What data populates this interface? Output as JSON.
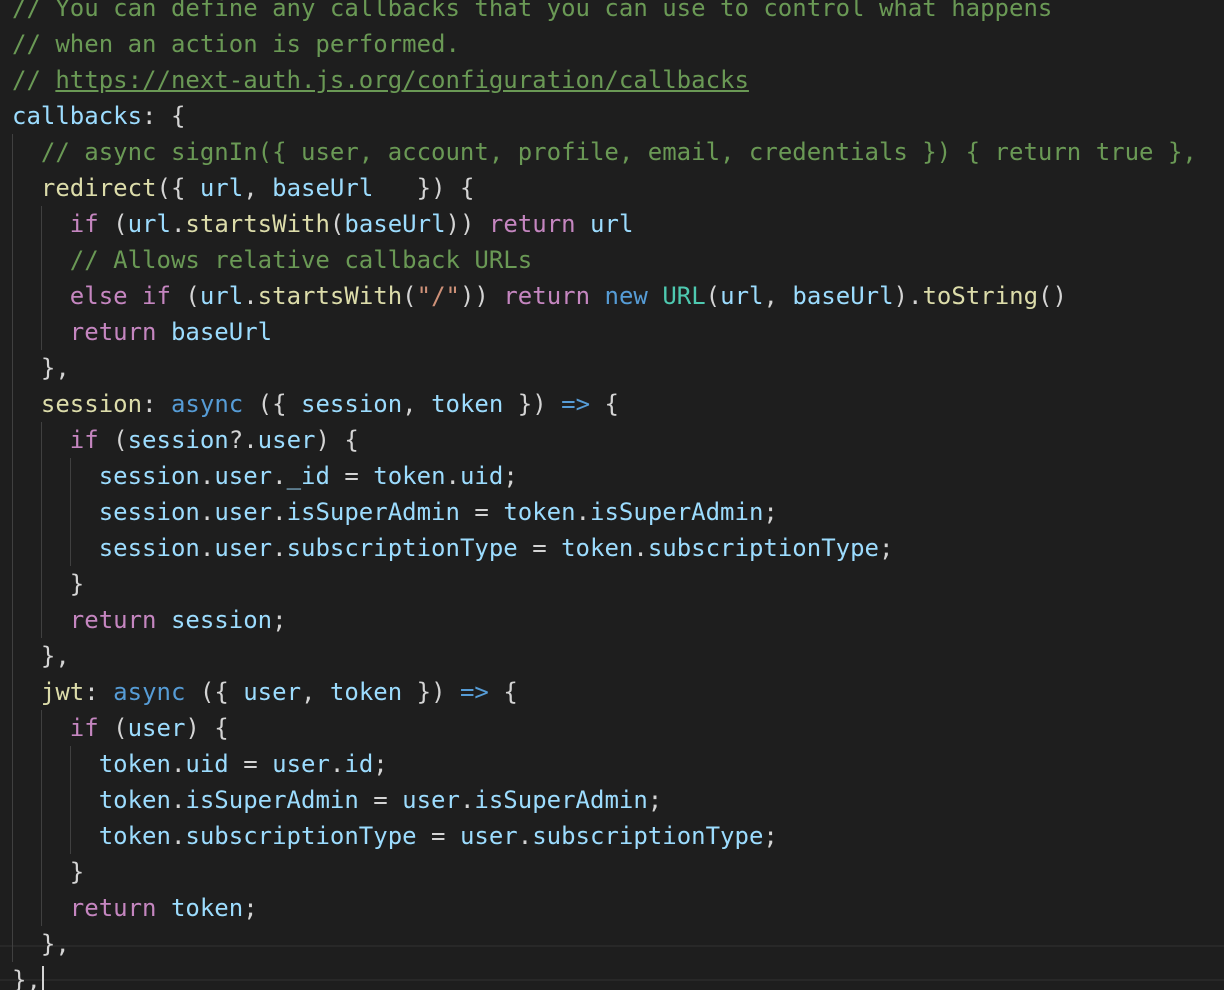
{
  "editor": {
    "lines": [
      [
        [
          "c",
          "// You can define any callbacks that you can use to control what happens"
        ]
      ],
      [
        [
          "c",
          "// when an action is performed."
        ]
      ],
      [
        [
          "c",
          "// "
        ],
        [
          "cu",
          "https://next-auth.js.org/configuration/callbacks"
        ]
      ],
      [
        [
          "v",
          "callbacks"
        ],
        [
          "p",
          ": {"
        ]
      ],
      [
        [
          "p",
          "  "
        ],
        [
          "c",
          "// async signIn({ user, account, profile, email, credentials }) { return true },"
        ]
      ],
      [
        [
          "p",
          "  "
        ],
        [
          "f",
          "redirect"
        ],
        [
          "p",
          "({ "
        ],
        [
          "v",
          "url"
        ],
        [
          "p",
          ", "
        ],
        [
          "v",
          "baseUrl"
        ],
        [
          "p",
          "   }) {"
        ]
      ],
      [
        [
          "p",
          "    "
        ],
        [
          "k",
          "if"
        ],
        [
          "p",
          " ("
        ],
        [
          "v",
          "url"
        ],
        [
          "p",
          "."
        ],
        [
          "f",
          "startsWith"
        ],
        [
          "p",
          "("
        ],
        [
          "v",
          "baseUrl"
        ],
        [
          "p",
          ")) "
        ],
        [
          "k",
          "return"
        ],
        [
          "p",
          " "
        ],
        [
          "v",
          "url"
        ]
      ],
      [
        [
          "p",
          "    "
        ],
        [
          "c",
          "// Allows relative callback URLs"
        ]
      ],
      [
        [
          "p",
          "    "
        ],
        [
          "k",
          "else if"
        ],
        [
          "p",
          " ("
        ],
        [
          "v",
          "url"
        ],
        [
          "p",
          "."
        ],
        [
          "f",
          "startsWith"
        ],
        [
          "p",
          "("
        ],
        [
          "s",
          "\"/\""
        ],
        [
          "p",
          ")) "
        ],
        [
          "k",
          "return"
        ],
        [
          "p",
          " "
        ],
        [
          "kb",
          "new"
        ],
        [
          "p",
          " "
        ],
        [
          "t",
          "URL"
        ],
        [
          "p",
          "("
        ],
        [
          "v",
          "url"
        ],
        [
          "p",
          ", "
        ],
        [
          "v",
          "baseUrl"
        ],
        [
          "p",
          ")."
        ],
        [
          "f",
          "toString"
        ],
        [
          "p",
          "()"
        ]
      ],
      [
        [
          "p",
          "    "
        ],
        [
          "k",
          "return"
        ],
        [
          "p",
          " "
        ],
        [
          "v",
          "baseUrl"
        ]
      ],
      [
        [
          "p",
          "  },"
        ]
      ],
      [
        [
          "p",
          "  "
        ],
        [
          "f",
          "session"
        ],
        [
          "p",
          ": "
        ],
        [
          "kb",
          "async"
        ],
        [
          "p",
          " ({ "
        ],
        [
          "v",
          "session"
        ],
        [
          "p",
          ", "
        ],
        [
          "v",
          "token"
        ],
        [
          "p",
          " }) "
        ],
        [
          "kb",
          "=>"
        ],
        [
          "p",
          " {"
        ]
      ],
      [
        [
          "p",
          "    "
        ],
        [
          "k",
          "if"
        ],
        [
          "p",
          " ("
        ],
        [
          "v",
          "session"
        ],
        [
          "p",
          "?."
        ],
        [
          "v",
          "user"
        ],
        [
          "p",
          ") {"
        ]
      ],
      [
        [
          "p",
          "      "
        ],
        [
          "v",
          "session"
        ],
        [
          "p",
          "."
        ],
        [
          "v",
          "user"
        ],
        [
          "p",
          "."
        ],
        [
          "v",
          "_id"
        ],
        [
          "p",
          " = "
        ],
        [
          "v",
          "token"
        ],
        [
          "p",
          "."
        ],
        [
          "v",
          "uid"
        ],
        [
          "p",
          ";"
        ]
      ],
      [
        [
          "p",
          "      "
        ],
        [
          "v",
          "session"
        ],
        [
          "p",
          "."
        ],
        [
          "v",
          "user"
        ],
        [
          "p",
          "."
        ],
        [
          "v",
          "isSuperAdmin"
        ],
        [
          "p",
          " = "
        ],
        [
          "v",
          "token"
        ],
        [
          "p",
          "."
        ],
        [
          "v",
          "isSuperAdmin"
        ],
        [
          "p",
          ";"
        ]
      ],
      [
        [
          "p",
          "      "
        ],
        [
          "v",
          "session"
        ],
        [
          "p",
          "."
        ],
        [
          "v",
          "user"
        ],
        [
          "p",
          "."
        ],
        [
          "v",
          "subscriptionType"
        ],
        [
          "p",
          " = "
        ],
        [
          "v",
          "token"
        ],
        [
          "p",
          "."
        ],
        [
          "v",
          "subscriptionType"
        ],
        [
          "p",
          ";"
        ]
      ],
      [
        [
          "p",
          "    }"
        ]
      ],
      [
        [
          "p",
          "    "
        ],
        [
          "k",
          "return"
        ],
        [
          "p",
          " "
        ],
        [
          "v",
          "session"
        ],
        [
          "p",
          ";"
        ]
      ],
      [
        [
          "p",
          "  },"
        ]
      ],
      [
        [
          "p",
          "  "
        ],
        [
          "f",
          "jwt"
        ],
        [
          "p",
          ": "
        ],
        [
          "kb",
          "async"
        ],
        [
          "p",
          " ({ "
        ],
        [
          "v",
          "user"
        ],
        [
          "p",
          ", "
        ],
        [
          "v",
          "token"
        ],
        [
          "p",
          " }) "
        ],
        [
          "kb",
          "=>"
        ],
        [
          "p",
          " {"
        ]
      ],
      [
        [
          "p",
          "    "
        ],
        [
          "k",
          "if"
        ],
        [
          "p",
          " ("
        ],
        [
          "v",
          "user"
        ],
        [
          "p",
          ") {"
        ]
      ],
      [
        [
          "p",
          "      "
        ],
        [
          "v",
          "token"
        ],
        [
          "p",
          "."
        ],
        [
          "v",
          "uid"
        ],
        [
          "p",
          " = "
        ],
        [
          "v",
          "user"
        ],
        [
          "p",
          "."
        ],
        [
          "v",
          "id"
        ],
        [
          "p",
          ";"
        ]
      ],
      [
        [
          "p",
          "      "
        ],
        [
          "v",
          "token"
        ],
        [
          "p",
          "."
        ],
        [
          "v",
          "isSuperAdmin"
        ],
        [
          "p",
          " = "
        ],
        [
          "v",
          "user"
        ],
        [
          "p",
          "."
        ],
        [
          "v",
          "isSuperAdmin"
        ],
        [
          "p",
          ";"
        ]
      ],
      [
        [
          "p",
          "      "
        ],
        [
          "v",
          "token"
        ],
        [
          "p",
          "."
        ],
        [
          "v",
          "subscriptionType"
        ],
        [
          "p",
          " = "
        ],
        [
          "v",
          "user"
        ],
        [
          "p",
          "."
        ],
        [
          "v",
          "subscriptionType"
        ],
        [
          "p",
          ";"
        ]
      ],
      [
        [
          "p",
          "    }"
        ]
      ],
      [
        [
          "p",
          "    "
        ],
        [
          "k",
          "return"
        ],
        [
          "p",
          " "
        ],
        [
          "v",
          "token"
        ],
        [
          "p",
          ";"
        ]
      ],
      [
        [
          "p",
          "  },"
        ]
      ],
      [
        [
          "p",
          "},"
        ]
      ]
    ]
  }
}
